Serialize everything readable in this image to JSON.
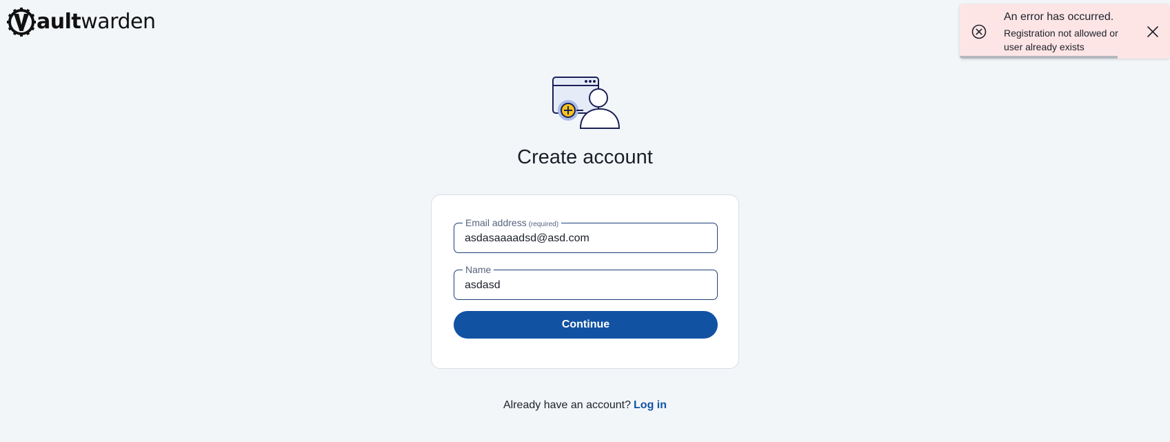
{
  "logo": {
    "bold_text": "ault",
    "light_text": "warden"
  },
  "page": {
    "title": "Create account"
  },
  "form": {
    "email": {
      "label": "Email address",
      "required_label": "(required)",
      "value": "asdasaaaadsd@asd.com"
    },
    "name": {
      "label": "Name",
      "value": "asdasd"
    },
    "continue_label": "Continue"
  },
  "footer": {
    "prompt": "Already have an account?",
    "login_label": "Log in"
  },
  "toast": {
    "title": "An error has occurred.",
    "message": "Registration not allowed or user already exists",
    "progress_fraction": 0.75,
    "icon": "error-circle-x-icon"
  },
  "colors": {
    "background": "#f3f6f9",
    "primary": "#1252a3",
    "toast_bg": "#fde5e6",
    "illustration_accent": "#f7c21b"
  }
}
